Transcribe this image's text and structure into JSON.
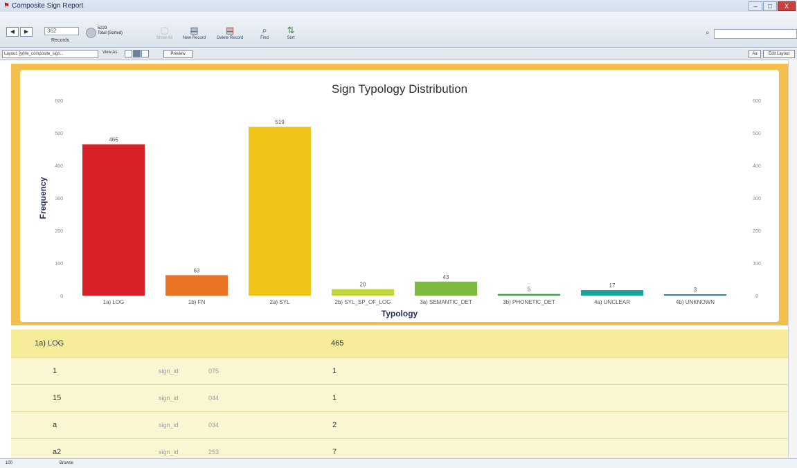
{
  "window": {
    "title": "Composite Sign Report",
    "controls": [
      "–",
      "□",
      "X"
    ]
  },
  "toolbar": {
    "nav_prev": "◀",
    "nav_next": "▶",
    "current_record": "362",
    "records_label": "Records",
    "total_count": "5229",
    "total_label": "Total (Sorted)",
    "buttons": [
      {
        "label": "Show All",
        "icon": "show-all-icon",
        "enabled": false
      },
      {
        "label": "New Record",
        "icon": "new-record-icon",
        "enabled": true
      },
      {
        "label": "Delete Record",
        "icon": "delete-record-icon",
        "enabled": true
      },
      {
        "label": "Find",
        "icon": "find-icon",
        "enabled": true
      },
      {
        "label": "Sort",
        "icon": "sort-icon",
        "enabled": true
      }
    ],
    "search_placeholder": ""
  },
  "layoutbar": {
    "layout_label": "Layout: [y(life_composite_sign...",
    "view_as": "View As:",
    "preview": "Preview",
    "aa": "Aa",
    "edit_layout": "Edit Layout"
  },
  "chart_data": {
    "type": "bar",
    "title": "Sign Typology Distribution",
    "xlabel": "Typology",
    "ylabel": "Frequency",
    "ylim": [
      0,
      600
    ],
    "yticks": [
      0,
      100,
      200,
      300,
      400,
      500,
      600
    ],
    "categories": [
      "1a) LOG",
      "1b) FN",
      "2a) SYL",
      "2b) SYL_SP_OF_LOG",
      "3a) SEMANTIC_DET",
      "3b) PHONETIC_DET",
      "4a) UNCLEAR",
      "4b) UNKNOWN"
    ],
    "values": [
      465,
      63,
      519,
      20,
      43,
      5,
      17,
      3
    ],
    "colors": [
      "#d72028",
      "#e87424",
      "#f0c419",
      "#c2d63b",
      "#7cbb3f",
      "#3fa14a",
      "#1aa39a",
      "#3a7cb6"
    ],
    "grid": false,
    "legend": "none",
    "secondary_axis": true
  },
  "group": {
    "label": "1a) LOG",
    "count": "465"
  },
  "rows": [
    {
      "sign": "1",
      "field": "sign_id",
      "id": "075",
      "count": "1"
    },
    {
      "sign": "15",
      "field": "sign_id",
      "id": "044",
      "count": "1"
    },
    {
      "sign": "a",
      "field": "sign_id",
      "id": "034",
      "count": "2"
    },
    {
      "sign": "a2",
      "field": "sign_id",
      "id": "253",
      "count": "7"
    }
  ],
  "status": {
    "zoom": "100",
    "mode": "Browse"
  }
}
